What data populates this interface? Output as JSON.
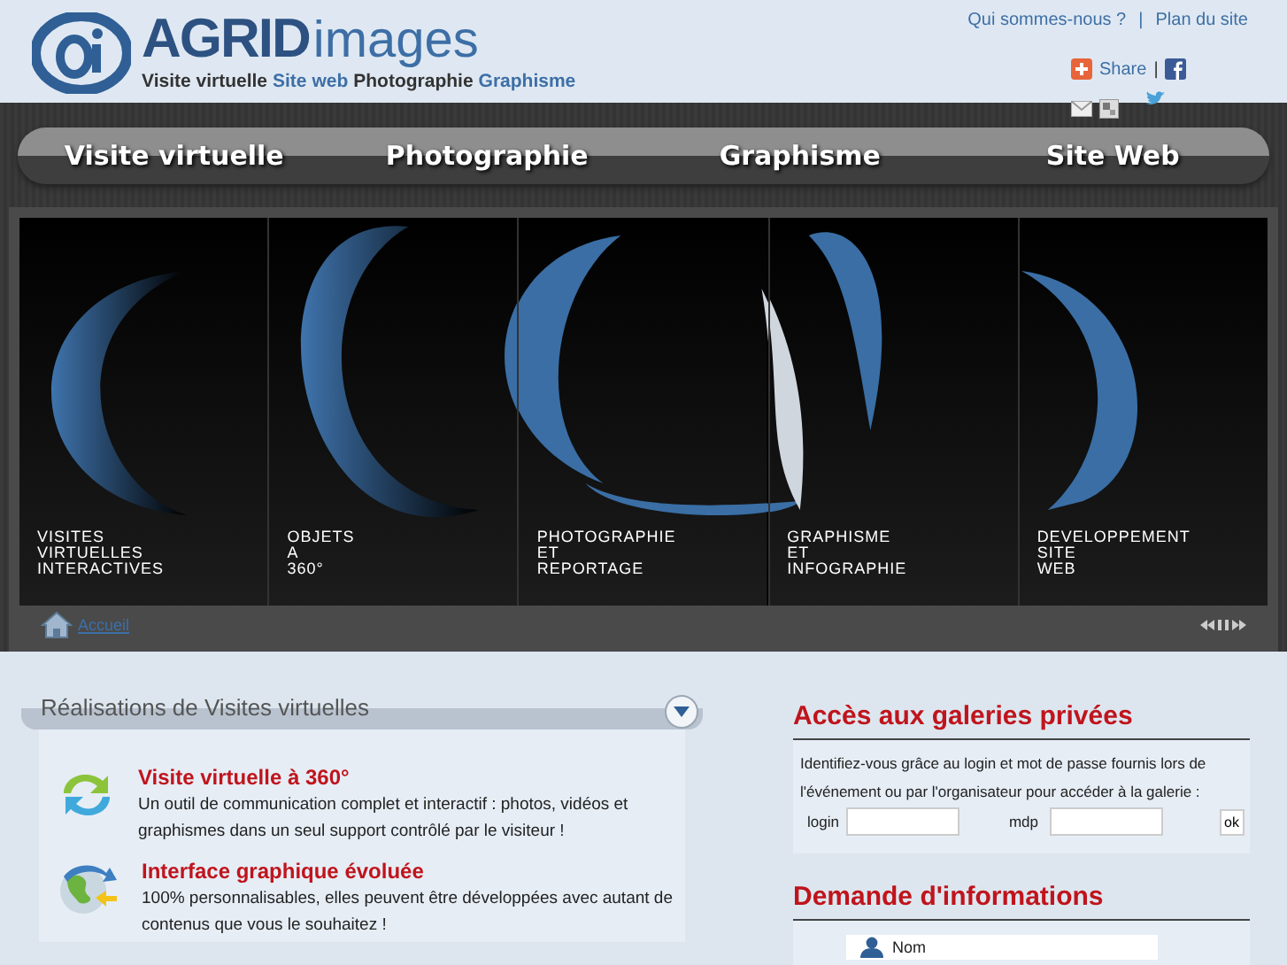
{
  "header": {
    "logo_word": "AGRID",
    "logo_suffix": "images",
    "tagline": [
      {
        "text": "Visite virtuelle",
        "highlight": false
      },
      {
        "text": "Site web",
        "highlight": true
      },
      {
        "text": "Photographie",
        "highlight": false
      },
      {
        "text": "Graphisme",
        "highlight": true
      }
    ],
    "links": [
      "Qui sommes-nous ?",
      "Plan du site"
    ],
    "link_separator": "|",
    "share": "Share",
    "share_separator": "|"
  },
  "nav": [
    "Visite virtuelle",
    "Photographie",
    "Graphisme",
    "Site Web"
  ],
  "slider": {
    "panels": [
      {
        "lines": [
          "VISITES",
          "VIRTUELLES",
          "INTERACTIVES"
        ]
      },
      {
        "lines": [
          "OBJETS",
          "A",
          "360°"
        ]
      },
      {
        "lines": [
          "PHOTOGRAPHIE",
          "ET",
          "REPORTAGE"
        ]
      },
      {
        "lines": [
          "GRAPHISME",
          "ET",
          "INFOGRAPHIE"
        ]
      },
      {
        "lines": [
          "DEVELOPPEMENT",
          "SITE",
          "WEB"
        ]
      }
    ],
    "home_link": "Accueil"
  },
  "realisations": {
    "title": "Réalisations de Visites virtuelles",
    "items": [
      {
        "kind": "sync",
        "title": "Visite virtuelle à 360°",
        "text": "Un outil de communication complet et interactif : photos, vidéos et graphismes dans un seul support contrôlé par le visiteur !"
      },
      {
        "kind": "globe",
        "title": "Interface graphique évoluée",
        "text": "100% personnalisables, elles peuvent être développées avec autant de contenus que vous le souhaitez !"
      }
    ]
  },
  "access": {
    "title": "Accès aux galeries privées",
    "text": "Identifiez-vous grâce au login et mot de passe fournis lors de l'événement ou par l'organisateur pour accéder à la galerie :",
    "login_label": "login",
    "password_label": "mdp",
    "submit": "ok"
  },
  "contact": {
    "title": "Demande d'informations",
    "name_field": {
      "placeholder": "Nom"
    }
  }
}
